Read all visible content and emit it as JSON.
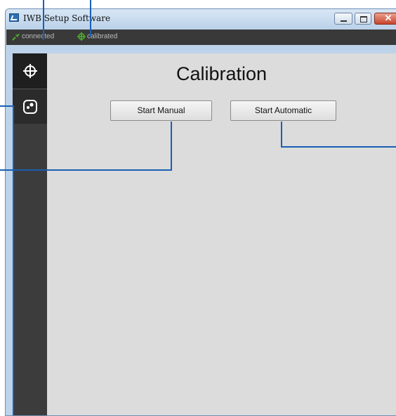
{
  "window": {
    "title": "IWB Setup Software",
    "close_glyph": "✕"
  },
  "status": {
    "connected_label": "connected",
    "calibrated_label": "calibrated",
    "connected_icon": "plug-icon",
    "calibrated_icon": "crosshair-icon",
    "indicator_color": "#4caf2a"
  },
  "sidebar": {
    "items": [
      {
        "name": "calibration",
        "icon": "crosshair-icon",
        "active": true
      },
      {
        "name": "display",
        "icon": "dots-face-icon",
        "active": false
      }
    ]
  },
  "main": {
    "title": "Calibration",
    "start_manual_label": "Start Manual",
    "start_automatic_label": "Start Automatic"
  },
  "colors": {
    "sidebar": "#3c3c3c",
    "content_bg": "#dcdcdc",
    "status_bar": "#393939",
    "callout": "#1a5fb4"
  }
}
